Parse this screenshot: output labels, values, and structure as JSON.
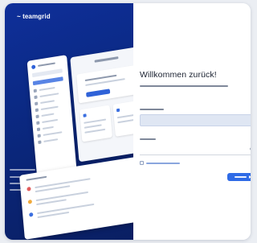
{
  "brand": {
    "logo_text": "~ teamgrid",
    "accent": "#0b2a86"
  },
  "login": {
    "heading": "Willkommen zurück!",
    "submit_color": "#2f6be6"
  },
  "icons": {
    "logo": "teamgrid-logo-icon",
    "password_toggle": "eye-icon",
    "submit_arrow": "arrow-right-icon"
  }
}
